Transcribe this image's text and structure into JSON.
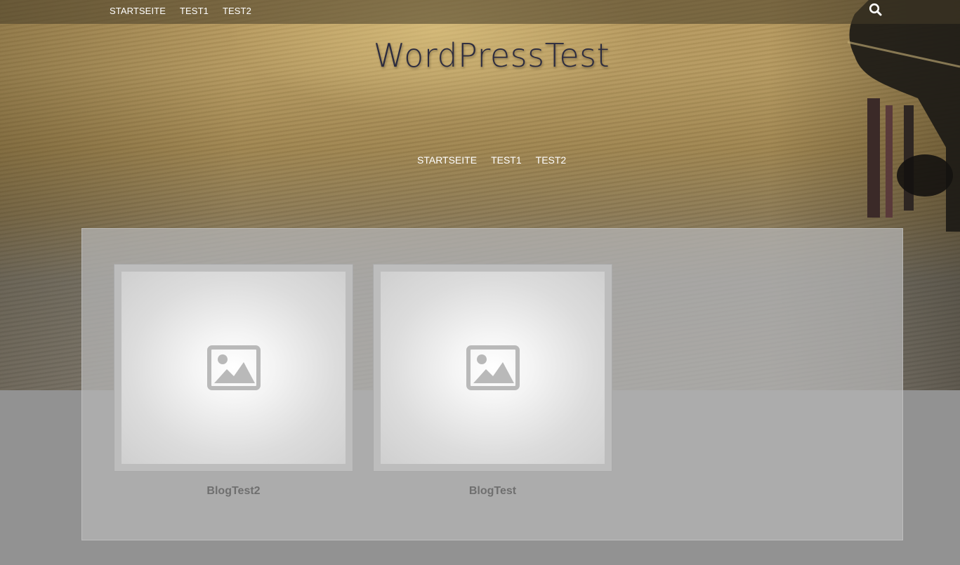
{
  "top_nav": {
    "items": [
      {
        "label": "STARTSEITE"
      },
      {
        "label": "TEST1"
      },
      {
        "label": "TEST2"
      }
    ],
    "search_icon": "search-icon"
  },
  "site": {
    "title": "WordPressTest"
  },
  "main_nav": {
    "items": [
      {
        "label": "STARTSEITE"
      },
      {
        "label": "TEST1"
      },
      {
        "label": "TEST2"
      }
    ]
  },
  "posts": [
    {
      "title": "BlogTest2",
      "thumbnail_icon": "image-placeholder-icon"
    },
    {
      "title": "BlogTest",
      "thumbnail_icon": "image-placeholder-icon"
    }
  ],
  "colors": {
    "title": "#2b2b3f",
    "nav_text": "#ffffff",
    "post_title": "#6f6f6f",
    "panel": "#b4b4b4"
  }
}
